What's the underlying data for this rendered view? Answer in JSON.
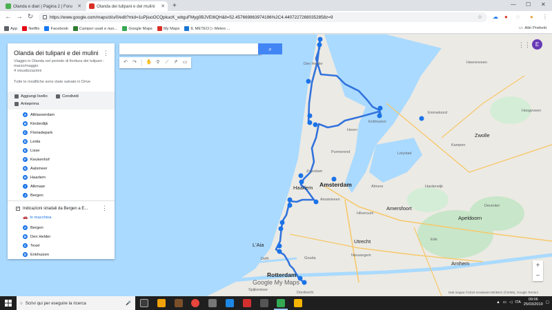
{
  "tabs": [
    {
      "title": "Olanda e diari | Pagina 2 | Foru",
      "active": false,
      "color": "#4caf50"
    },
    {
      "title": "Olanda dei tulipani e dei mulini",
      "active": true,
      "color": "#d93025"
    }
  ],
  "browser": {
    "url": "https://www.google.com/maps/d/u/0/edit?mid=1uPjiuoOCQpkucK_wbguFMyg0BJVEI6QH&ll=52.457669863974196%2C4.44072272680352858z=9"
  },
  "bookmarks": [
    {
      "label": "App",
      "color": "#5f6368"
    },
    {
      "label": "Netflix",
      "color": "#e50914"
    },
    {
      "label": "Facebook",
      "color": "#1877f2"
    },
    {
      "label": "Camper usati e nuo...",
      "color": "#2e7d32"
    },
    {
      "label": "Google Maps",
      "color": "#34a853"
    },
    {
      "label": "My Maps",
      "color": "#d93025"
    },
    {
      "label": "IL METEO ▷ Meteo ...",
      "color": "#1976d2"
    }
  ],
  "bookmarks_other": "Altri Preferiti",
  "panel": {
    "title": "Olanda dei tulipani e dei mulini",
    "description": "Viaggio in Olanda nel periodo di fioritura dei tulipani - marzo/maggio",
    "views": "4 visualizzazioni",
    "saved": "Tutte le modifiche sono state salvate in Drive",
    "add_layer": "Aggiungi livello",
    "share": "Condividi",
    "preview": "Anteprima",
    "places": [
      {
        "letter": "A",
        "label": "Alblasserdam"
      },
      {
        "letter": "B",
        "label": "Kinderdijk"
      },
      {
        "letter": "C",
        "label": "Floriadepark"
      },
      {
        "letter": "D",
        "label": "Leida"
      },
      {
        "letter": "E",
        "label": "Lisse"
      },
      {
        "letter": "F",
        "label": "Keukenhof"
      },
      {
        "letter": "G",
        "label": "Aalsmeer"
      },
      {
        "letter": "H",
        "label": "Haarlem"
      },
      {
        "letter": "I",
        "label": "Alkmaar"
      },
      {
        "letter": "J",
        "label": "Bergen"
      }
    ],
    "directions_title": "Indicazioni stradali da Bergen a E...",
    "mode": "In macchina",
    "route": [
      {
        "letter": "A",
        "label": "Bergen"
      },
      {
        "letter": "B",
        "label": "Den Helder"
      },
      {
        "letter": "C",
        "label": "Texel"
      },
      {
        "letter": "D",
        "label": "Enkhuizen"
      }
    ]
  },
  "map": {
    "cities": [
      {
        "name": "Amsterdam",
        "cls": "big"
      },
      {
        "name": "L'Aia",
        "cls": "city"
      },
      {
        "name": "Rotterdam",
        "cls": "big"
      },
      {
        "name": "Utrecht",
        "cls": "city"
      },
      {
        "name": "Haarlem",
        "cls": "city"
      },
      {
        "name": "Amersfoort",
        "cls": "city"
      },
      {
        "name": "Zwolle",
        "cls": "city"
      },
      {
        "name": "Apeldoorn",
        "cls": "city"
      },
      {
        "name": "Arnhem",
        "cls": "city"
      },
      {
        "name": "Hilversum",
        "cls": "label"
      },
      {
        "name": "Almere",
        "cls": "label"
      },
      {
        "name": "Lelystad",
        "cls": "label"
      },
      {
        "name": "Heerenveen",
        "cls": "label"
      },
      {
        "name": "Hoogeveen",
        "cls": "label"
      },
      {
        "name": "Deventer",
        "cls": "label"
      },
      {
        "name": "Gouda",
        "cls": "label"
      },
      {
        "name": "Delft",
        "cls": "label"
      },
      {
        "name": "Hoorn",
        "cls": "label"
      },
      {
        "name": "Emmeloord",
        "cls": "label"
      },
      {
        "name": "Kampen",
        "cls": "label"
      },
      {
        "name": "Harderwijk",
        "cls": "label"
      },
      {
        "name": "Ede",
        "cls": "label"
      },
      {
        "name": "Nieuwegein",
        "cls": "label"
      },
      {
        "name": "Den Helder",
        "cls": "label"
      },
      {
        "name": "Amstelveen",
        "cls": "label"
      },
      {
        "name": "Purmerend",
        "cls": "label"
      },
      {
        "name": "Zaandam",
        "cls": "label"
      },
      {
        "name": "Enkhuizen",
        "cls": "label"
      },
      {
        "name": "Spijkenisse",
        "cls": "label"
      },
      {
        "name": "Dordrecht",
        "cls": "label"
      }
    ],
    "attribution": "Dati mappa ©2019 GeoBasis-DE/BKG (©2009), Google   Termini",
    "logo": "Google My Maps"
  },
  "taskbar": {
    "search_placeholder": "Scrivi qui per eseguire la ricerca",
    "lang": "ITA",
    "time": "09:06",
    "date": "25/03/2019"
  },
  "avatar_letter": "E"
}
